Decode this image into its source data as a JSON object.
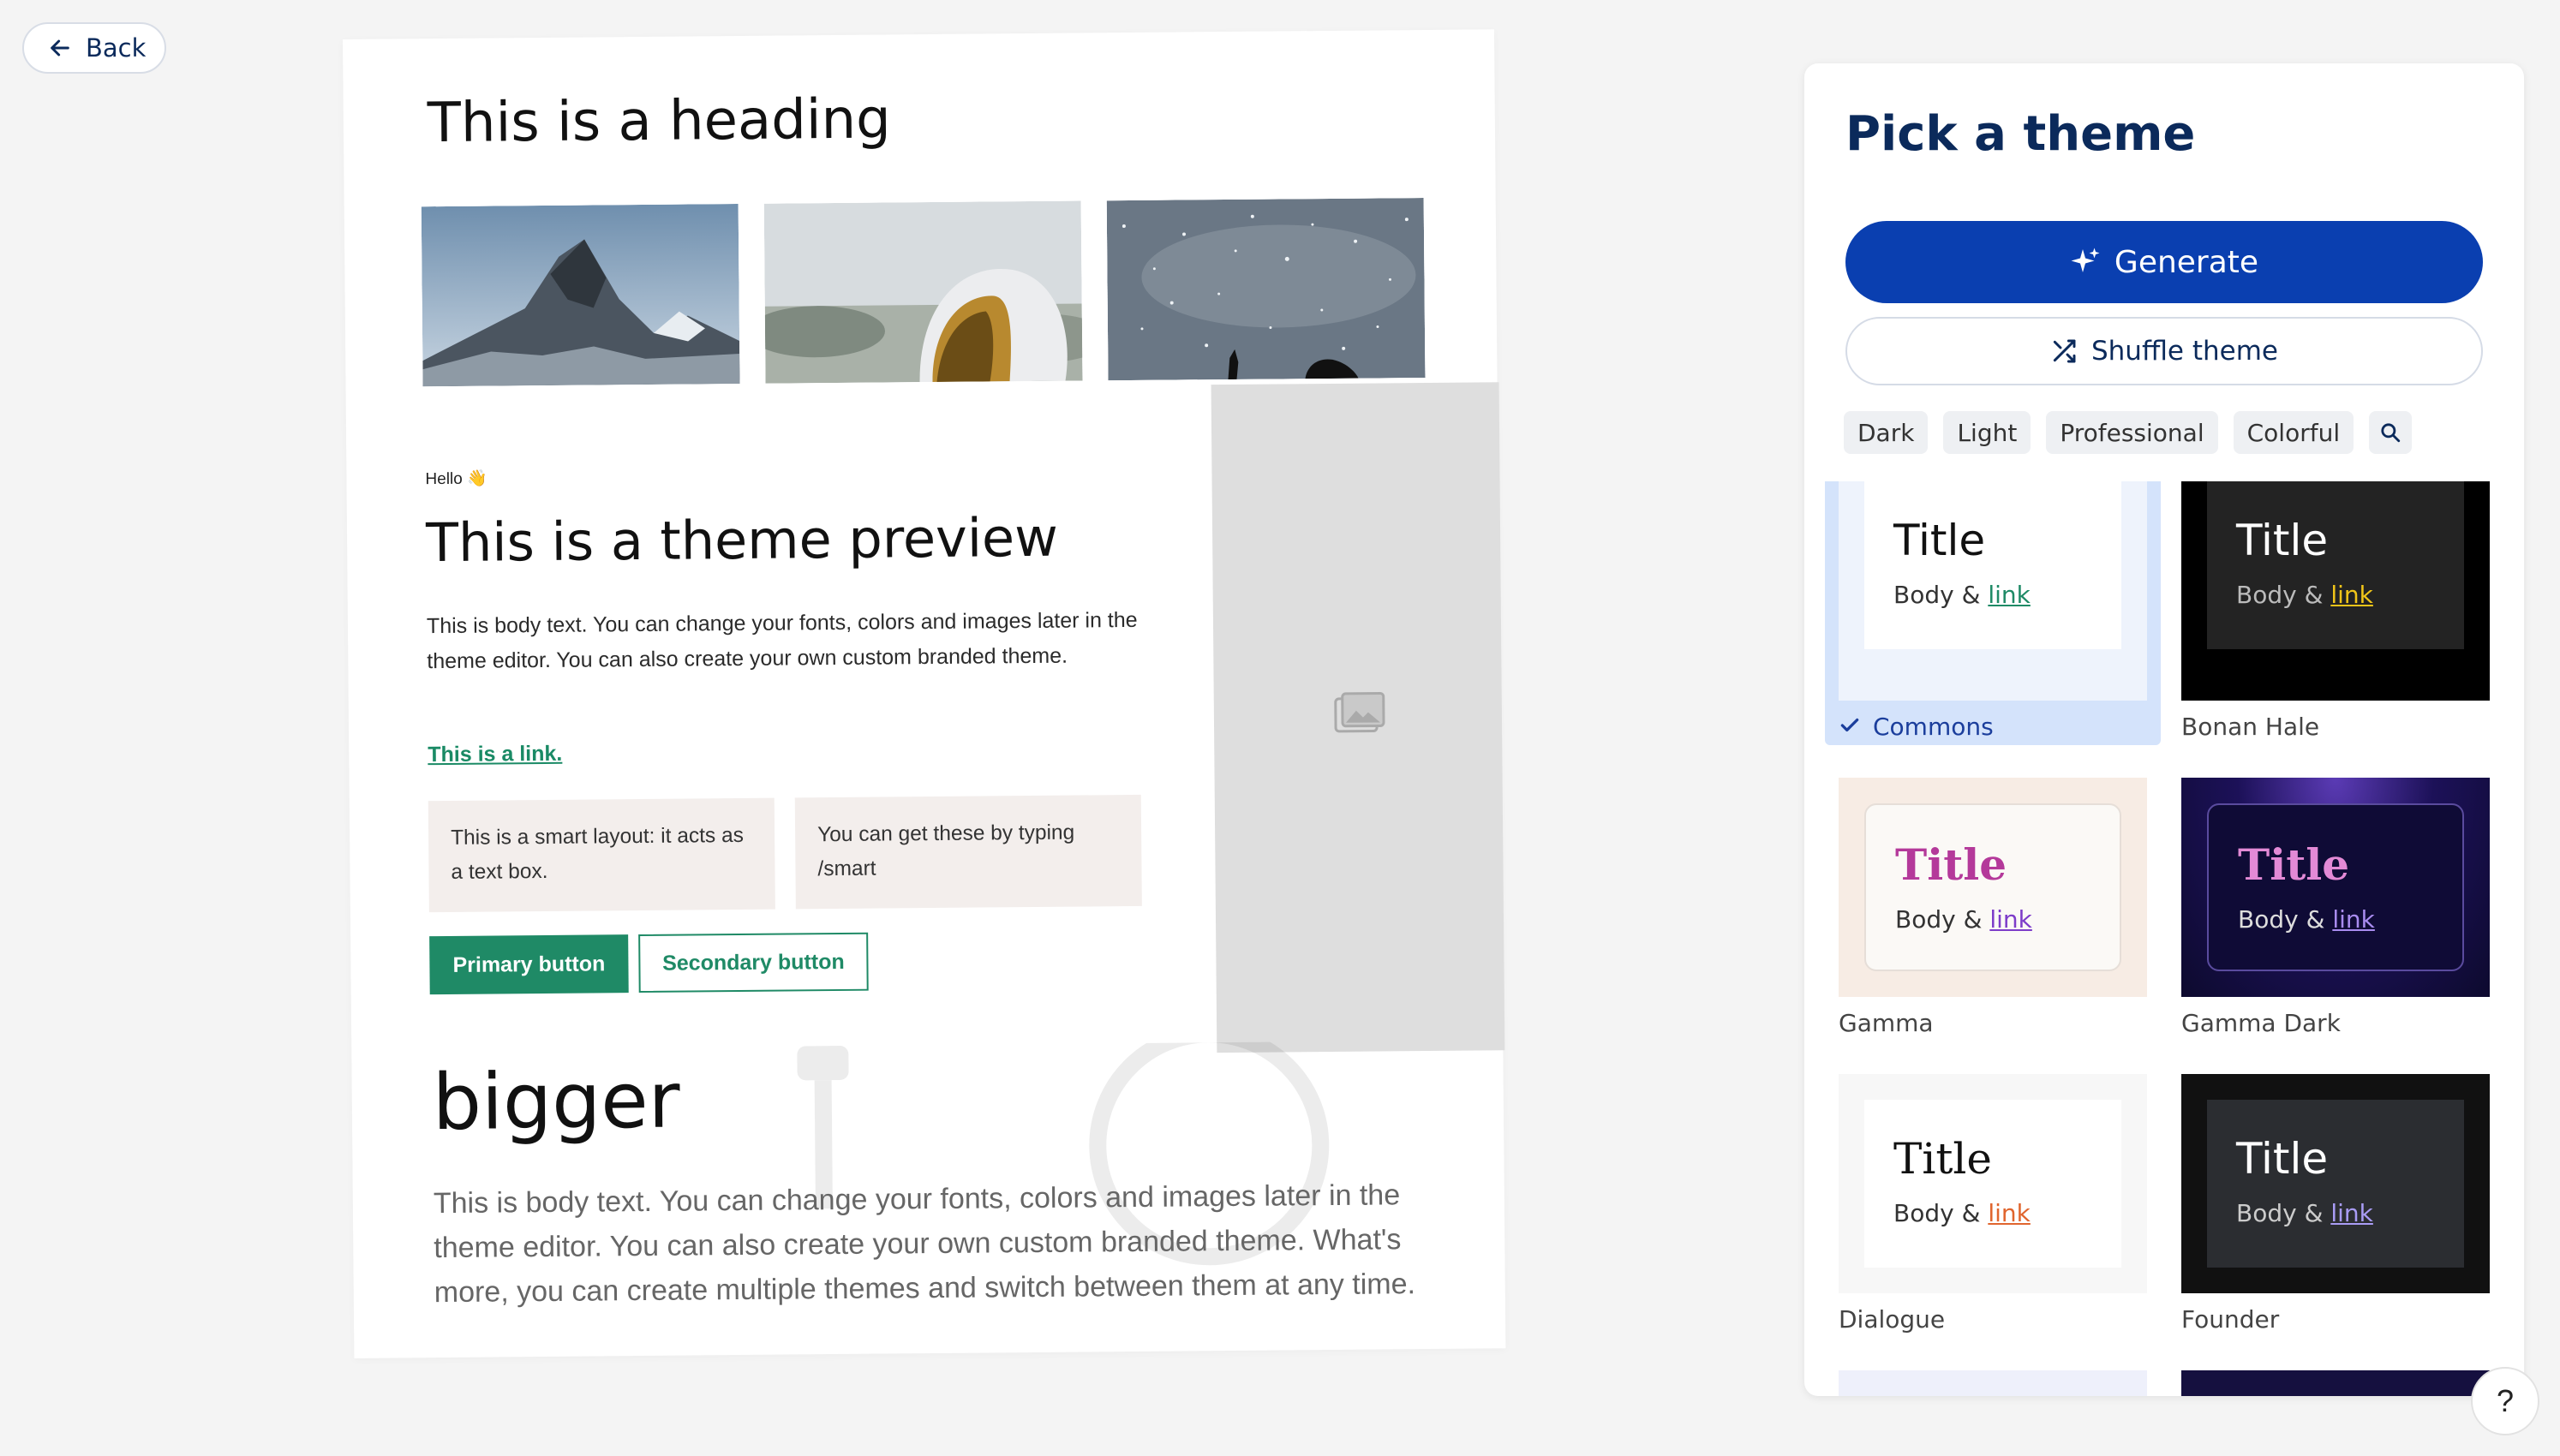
{
  "nav": {
    "back_label": "Back"
  },
  "preview": {
    "heading": "This is a heading",
    "hello": "Hello 👋",
    "title": "This is a theme preview",
    "body": "This is body text. You can change your fonts, colors and images later in the theme editor. You can also create your own custom branded theme.",
    "link": "This is a link.",
    "smart_box_1": "This is a smart layout: it acts as a text box.",
    "smart_box_2": "You can get these by typing /smart",
    "primary_button": "Primary button",
    "secondary_button": "Secondary button",
    "bigger_heading": "bigger",
    "bigger_body": "This is body text. You can change your fonts, colors and images later in the theme editor. You can also create your own custom branded theme. What's more, you can create multiple themes and switch between them at any time."
  },
  "panel": {
    "title": "Pick a theme",
    "generate_label": "Generate",
    "shuffle_label": "Shuffle theme",
    "filters": [
      "Dark",
      "Light",
      "Professional",
      "Colorful"
    ],
    "search_icon": "search-icon",
    "sample_title": "Title",
    "sample_body": "Body &",
    "sample_link": "link",
    "themes": [
      {
        "name": "Commons",
        "selected": true,
        "accent": "#1f8a66"
      },
      {
        "name": "Bonan Hale",
        "selected": false,
        "accent": "#f0c419"
      },
      {
        "name": "Gamma",
        "selected": false,
        "accent": "#7d3cc9"
      },
      {
        "name": "Gamma Dark",
        "selected": false,
        "accent": "#a98cf0"
      },
      {
        "name": "Dialogue",
        "selected": false,
        "accent": "#e0652e"
      },
      {
        "name": "Founder",
        "selected": false,
        "accent": "#a99cf5"
      }
    ]
  },
  "help": {
    "label": "?"
  },
  "colors": {
    "primary_green": "#1f8a66",
    "navy": "#0b2a5b",
    "generate_blue": "#0a3fb0",
    "selected_bg": "#d4e3fb"
  }
}
